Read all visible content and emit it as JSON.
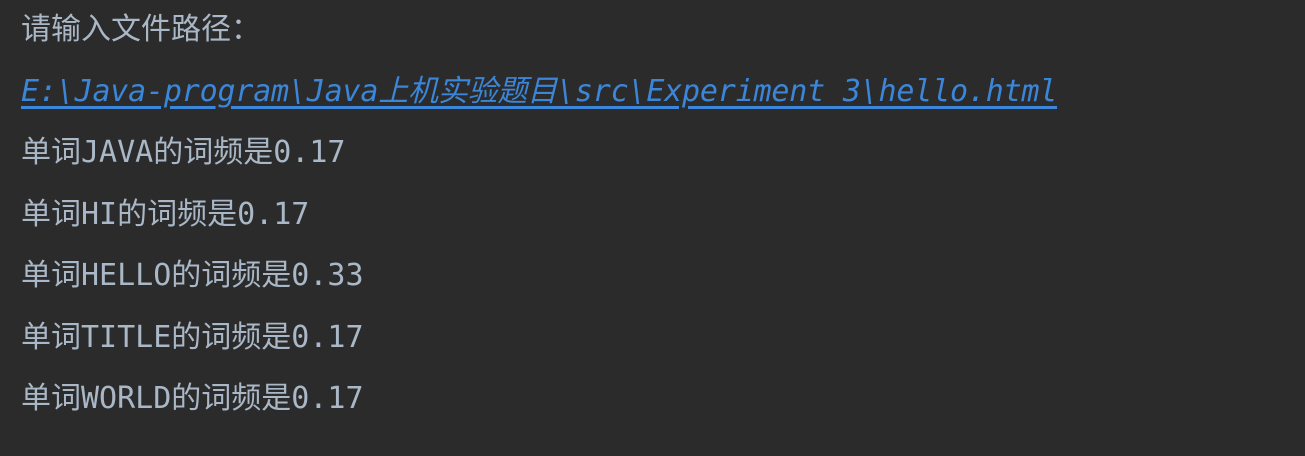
{
  "console": {
    "prompt": "请输入文件路径：",
    "file_path": "E:\\Java-program\\Java上机实验题目\\src\\Experiment_3\\hello.html",
    "results": [
      "单词JAVA的词频是0.17",
      "单词HI的词频是0.17",
      "单词HELLO的词频是0.33",
      "单词TITLE的词频是0.17",
      "单词WORLD的词频是0.17"
    ]
  },
  "colors": {
    "background": "#2b2b2b",
    "text": "#a9b7c6",
    "link": "#3b86d8"
  }
}
